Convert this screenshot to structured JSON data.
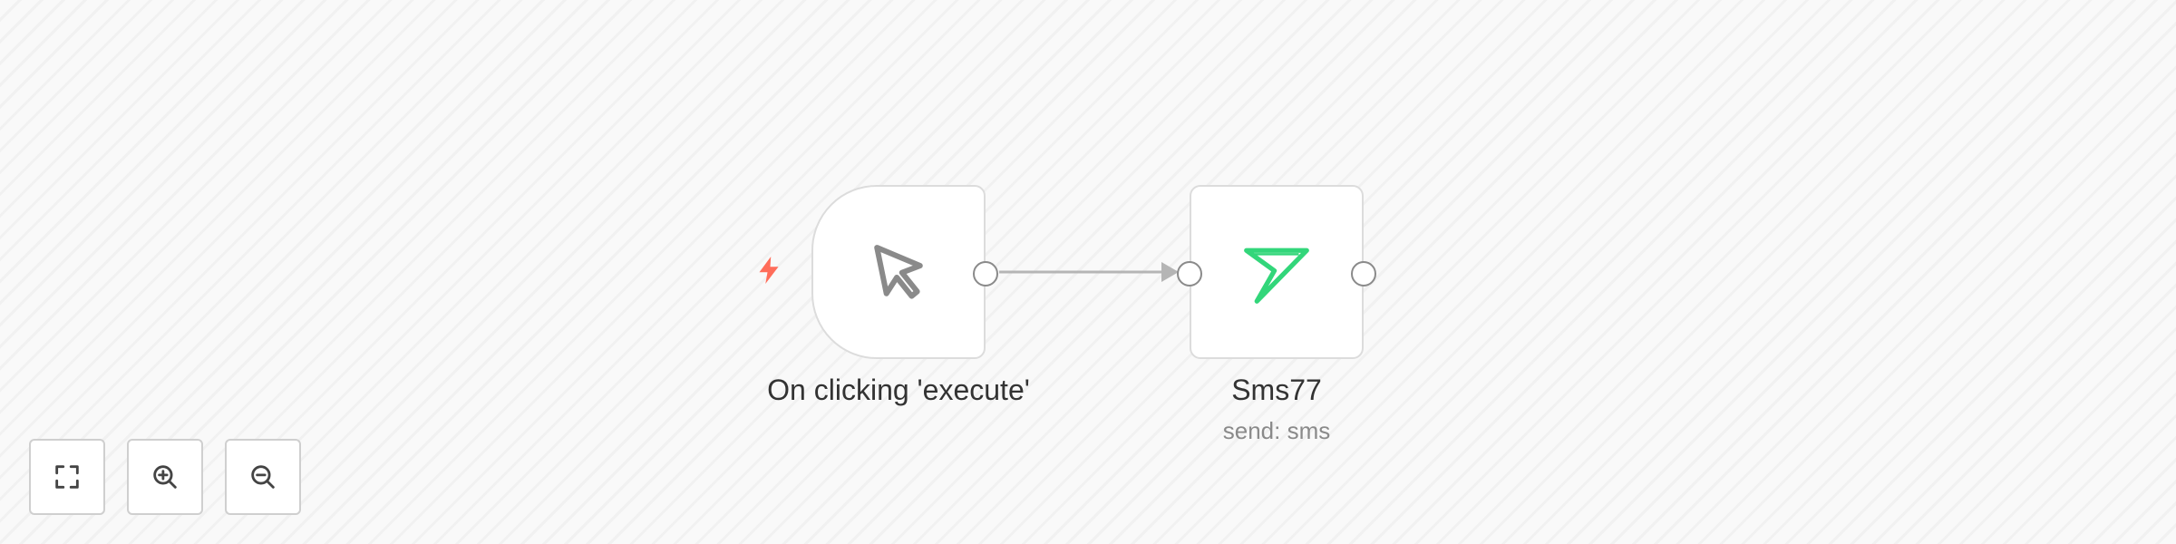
{
  "nodes": {
    "trigger": {
      "label": "On clicking 'execute'",
      "icon": "cursor-click-icon",
      "badge_icon": "lightning-bolt-icon"
    },
    "sms": {
      "label": "Sms77",
      "subtitle": "send: sms",
      "icon": "send-paper-plane-icon"
    }
  },
  "controls": {
    "buttons": [
      {
        "name": "fit-view-button",
        "icon": "expand-icon"
      },
      {
        "name": "zoom-in-button",
        "icon": "zoom-in-icon"
      },
      {
        "name": "zoom-out-button",
        "icon": "zoom-out-icon"
      }
    ]
  },
  "colors": {
    "trigger_bolt": "#ff6d5a",
    "sms_icon": "#32d67a",
    "cursor_icon": "#8a8a8a",
    "connection": "#b5b5b5"
  }
}
